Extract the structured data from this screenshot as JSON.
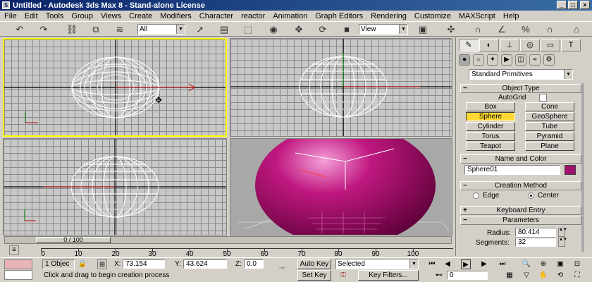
{
  "window": {
    "title": "Untitled - Autodesk 3ds Max 8 - Stand-alone License",
    "icon": "3ds-max-app-icon"
  },
  "menu": [
    "File",
    "Edit",
    "Tools",
    "Group",
    "Views",
    "Create",
    "Modifiers",
    "Character",
    "reactor",
    "Animation",
    "Graph Editors",
    "Rendering",
    "Customize",
    "MAXScript",
    "Help"
  ],
  "toolbar": {
    "selection_filter": "All",
    "reference_coord": "View"
  },
  "command_panel": {
    "category": "Standard Primitives",
    "object_type": {
      "header": "Object Type",
      "autogrid_label": "AutoGrid",
      "buttons": [
        "Box",
        "Cone",
        "Sphere",
        "GeoSphere",
        "Cylinder",
        "Tube",
        "Torus",
        "Pyramid",
        "Teapot",
        "Plane"
      ],
      "active": "Sphere"
    },
    "name_color": {
      "header": "Name and Color",
      "name": "Sphere01",
      "color": "#a0106e"
    },
    "creation_method": {
      "header": "Creation Method",
      "edge_label": "Edge",
      "center_label": "Center",
      "selected": "Center"
    },
    "keyboard_entry": {
      "header": "Keyboard Entry"
    },
    "parameters": {
      "header": "Parameters",
      "radius_label": "Radius:",
      "radius_value": "80.414",
      "segments_label": "Segments:",
      "segments_value": "32"
    }
  },
  "timeline": {
    "slider_label": "0 / 100",
    "ticks": [
      "0",
      "10",
      "20",
      "30",
      "40",
      "50",
      "60",
      "70",
      "80",
      "90",
      "100"
    ]
  },
  "status": {
    "selection_count": "1 Objec",
    "x_label": "X:",
    "x_value": "73.154",
    "y_label": "Y:",
    "y_value": "43.624",
    "z_label": "Z:",
    "z_value": "0.0",
    "auto_key": "Auto Key",
    "set_key": "Set Key",
    "key_mode": "Selected",
    "key_filters": "Key Filters...",
    "frame": "0",
    "prompt": "Click and drag to begin creation process"
  }
}
